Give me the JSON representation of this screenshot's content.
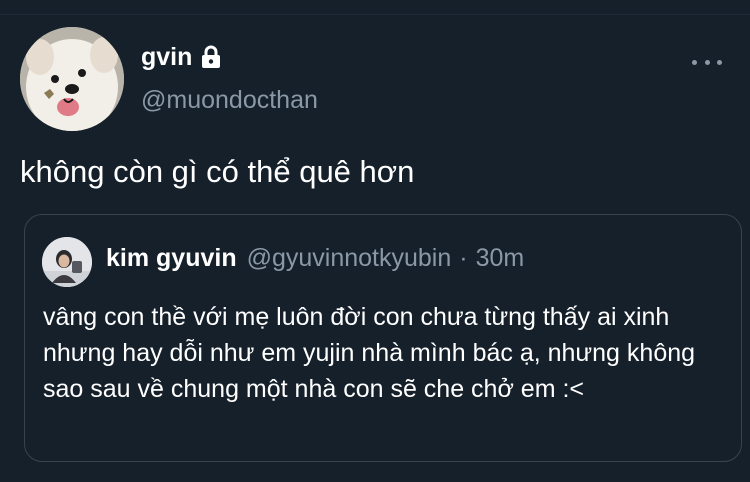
{
  "tweet": {
    "author": {
      "display_name": "gvin",
      "handle": "@muondocthan",
      "avatar_icon": "dog-avatar",
      "protected_icon": "lock-icon"
    },
    "more_icon": "more-horizontal-icon",
    "text": "không còn gì có thể quê hơn"
  },
  "quote": {
    "author": {
      "display_name": "kim gyuvin",
      "handle": "@gyuvinnotkyubin",
      "avatar_icon": "person-avatar"
    },
    "separator": "·",
    "time": "30m",
    "text": "vâng con thề với mẹ luôn đời con chưa từng thấy ai xinh nhưng hay dỗi như em yujin nhà mình bác ạ, nhưng không sao sau về chung một nhà con sẽ che chở em :<"
  },
  "colors": {
    "background": "#15202b",
    "text_primary": "#ffffff",
    "text_secondary": "#8b98a5",
    "border": "#38444d"
  }
}
